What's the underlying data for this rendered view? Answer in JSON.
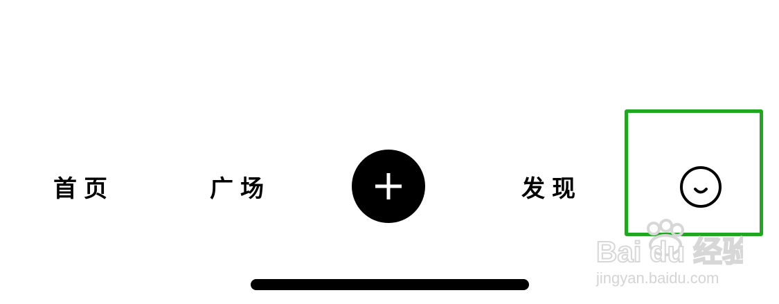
{
  "tabbar": {
    "home_label": "首页",
    "square_label": "广场",
    "add_icon": "plus-icon",
    "discover_label": "发现",
    "profile_icon": "smiley-face-icon"
  },
  "highlight": {
    "color": "#1fa71f"
  },
  "watermark": {
    "logo_text": "Bai du 经验",
    "site_text": "jingyan.baidu.com"
  }
}
